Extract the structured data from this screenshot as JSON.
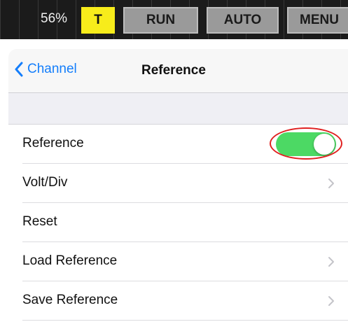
{
  "toolbar": {
    "battery": "56%",
    "trigger_label": "T",
    "run_label": "RUN",
    "auto_label": "AUTO",
    "menu_label": "MENU"
  },
  "popover": {
    "back_label": "Channel",
    "title": "Reference"
  },
  "settings": {
    "rows": [
      {
        "label": "Reference",
        "control": "toggle",
        "toggle_on": true
      },
      {
        "label": "Volt/Div",
        "control": "chevron"
      },
      {
        "label": "Reset",
        "control": "none"
      },
      {
        "label": "Load Reference",
        "control": "chevron"
      },
      {
        "label": "Save Reference",
        "control": "chevron"
      }
    ]
  },
  "icons": {
    "back": "chevron-left-icon",
    "disclosure": "chevron-right-icon"
  },
  "colors": {
    "accent_blue": "#147efb",
    "toggle_on": "#4cd964",
    "trigger_yellow": "#f7ec1b",
    "toolbar_bg": "#1b1b1b",
    "highlight_red": "#e02020"
  }
}
